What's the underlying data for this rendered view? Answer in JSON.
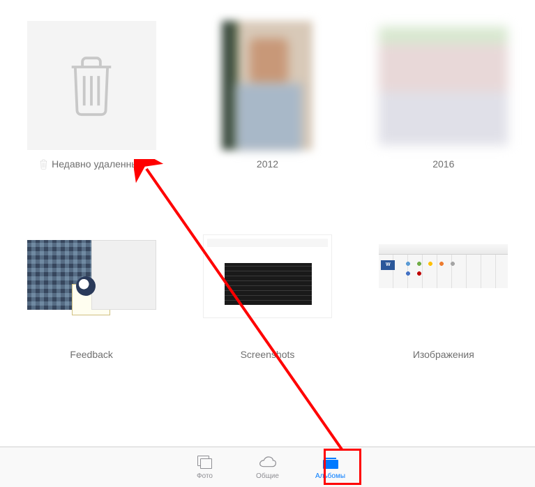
{
  "albums": [
    {
      "id": "recently-deleted",
      "label": "Недавно удаленные"
    },
    {
      "id": "2012",
      "label": "2012"
    },
    {
      "id": "2016",
      "label": "2016"
    },
    {
      "id": "feedback",
      "label": "Feedback"
    },
    {
      "id": "screenshots",
      "label": "Screenshots"
    },
    {
      "id": "images",
      "label": "Изображения"
    }
  ],
  "tabs": {
    "photos": "Фото",
    "shared": "Общие",
    "albums": "Альбомы"
  },
  "active_tab": "albums",
  "colors": {
    "accent": "#007aff",
    "inactive": "#8e8e93",
    "annotation": "#ff0000"
  }
}
